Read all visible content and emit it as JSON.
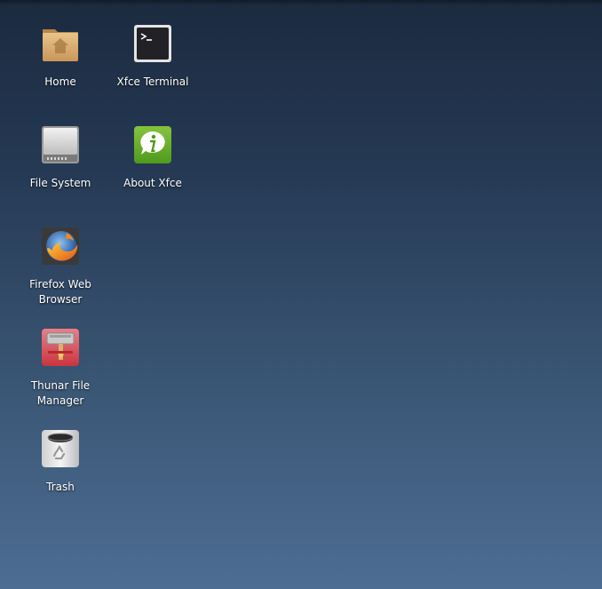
{
  "desktop": {
    "icons": [
      {
        "id": "home",
        "label": "Home",
        "icon": "home-folder-icon"
      },
      {
        "id": "terminal",
        "label": "Xfce Terminal",
        "icon": "terminal-icon"
      },
      {
        "id": "filesystem",
        "label": "File System",
        "icon": "drive-icon"
      },
      {
        "id": "about",
        "label": "About Xfce",
        "icon": "info-icon"
      },
      {
        "id": "firefox",
        "label": "Firefox Web Browser",
        "icon": "firefox-icon"
      },
      {
        "id": "thunar",
        "label": "Thunar File Manager",
        "icon": "thunar-icon"
      },
      {
        "id": "trash",
        "label": "Trash",
        "icon": "trash-icon"
      }
    ]
  },
  "colors": {
    "background_top": "#1b2a3f",
    "background_bottom": "#4d6d93",
    "label_text": "#ffffff"
  }
}
